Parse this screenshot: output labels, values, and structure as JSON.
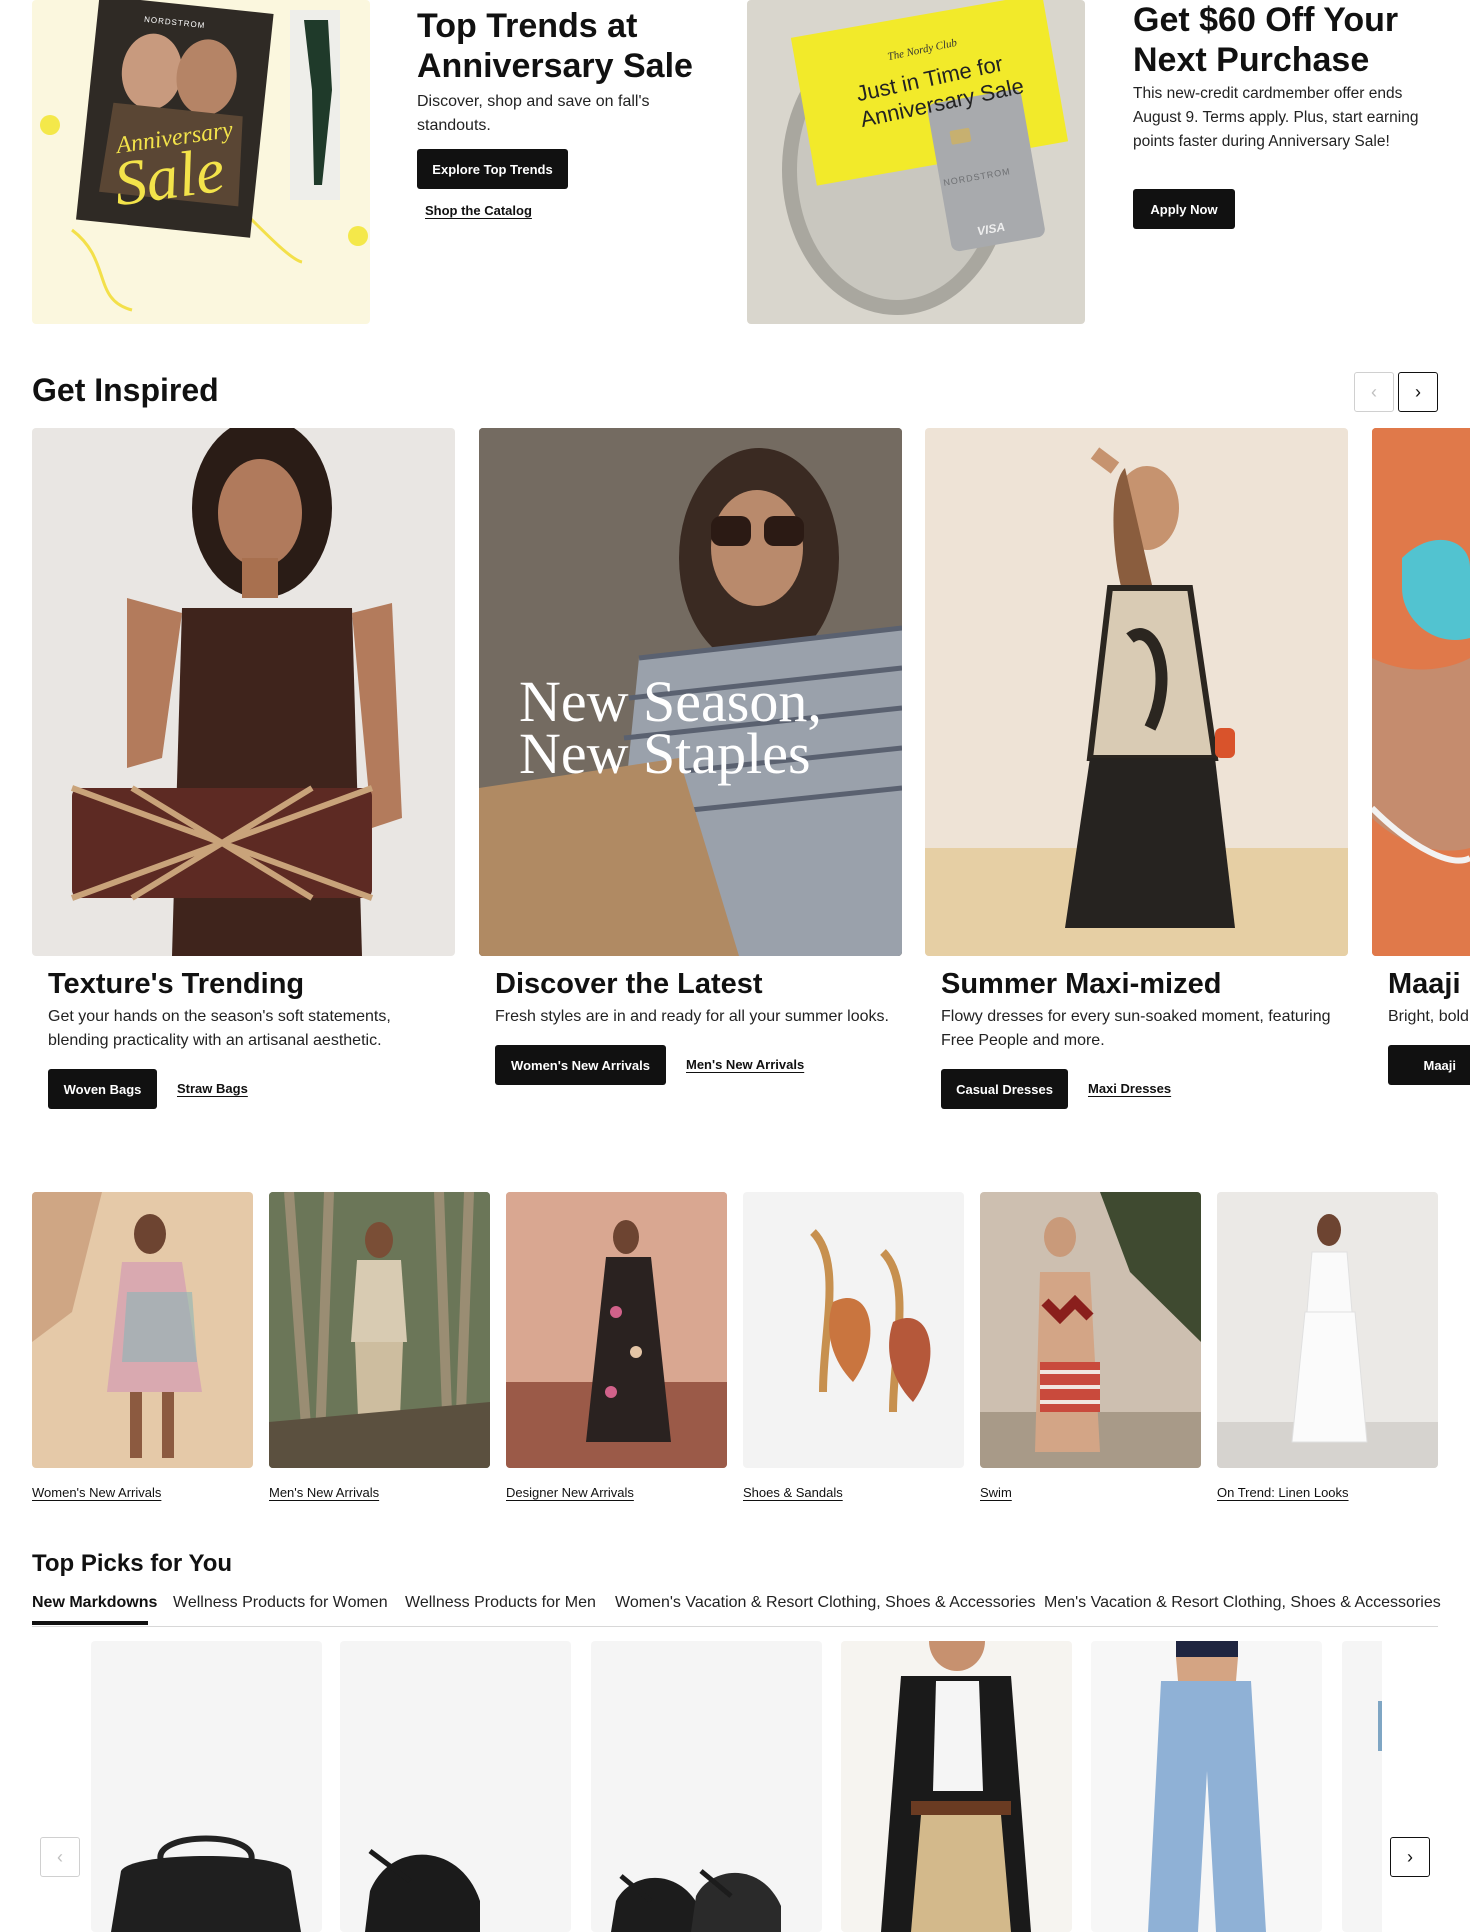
{
  "hero": {
    "catalog": {
      "brand": "NORDSTROM",
      "word1": "Anniversary",
      "word2": "Sale"
    },
    "trends": {
      "title_line1": "Top Trends at",
      "title_line2": "Anniversary Sale",
      "desc": "Discover, shop and save on fall's standouts.",
      "button": "Explore Top Trends",
      "link": "Shop the Catalog"
    },
    "card_image": {
      "note_line0": "The Nordy Club",
      "note_line1": "Just in Time for",
      "note_line2": "Anniversary Sale",
      "card_brand": "NORDSTROM",
      "card_network": "VISA"
    },
    "credit": {
      "title_line1": "Get $60 Off Your",
      "title_line2": "Next Purchase",
      "desc": "This new-credit cardmember offer ends August 9. Terms apply. Plus, start earning points faster during Anniversary Sale!",
      "button": "Apply Now"
    }
  },
  "inspired": {
    "title": "Get Inspired",
    "overlay_line1": "New Season,",
    "overlay_line2": "New Staples",
    "cards": [
      {
        "title": "Texture's Trending",
        "desc": "Get your hands on the season's soft statements, blending practicality with an artisanal aesthetic.",
        "button": "Woven Bags",
        "link": "Straw Bags"
      },
      {
        "title": "Discover the Latest",
        "desc": "Fresh styles are in and ready for all your summer looks.",
        "button": "Women's New Arrivals",
        "link": "Men's New Arrivals"
      },
      {
        "title": "Summer Maxi-mized",
        "desc": "Flowy dresses for every sun-soaked moment, featuring Free People and more.",
        "button": "Casual Dresses",
        "link": "Maxi Dresses"
      },
      {
        "title": "Maaji",
        "desc": "Bright, bold",
        "button": "Maaji"
      }
    ]
  },
  "categories": [
    "Women's New Arrivals",
    "Men's New Arrivals",
    "Designer New Arrivals",
    "Shoes & Sandals",
    "Swim",
    "On Trend: Linen Looks"
  ],
  "top_picks": {
    "title": "Top Picks for You",
    "tabs": [
      "New Markdowns",
      "Wellness Products for Women",
      "Wellness Products for Men",
      "Women's Vacation & Resort Clothing, Shoes & Accessories",
      "Men's Vacation & Resort Clothing, Shoes & Accessories"
    ]
  },
  "icons": {
    "prev": "chevron-left-icon",
    "next": "chevron-right-icon"
  },
  "colors": {
    "primary": "#111111",
    "background": "#ffffff",
    "accent_yellow": "#f2ea2a"
  }
}
